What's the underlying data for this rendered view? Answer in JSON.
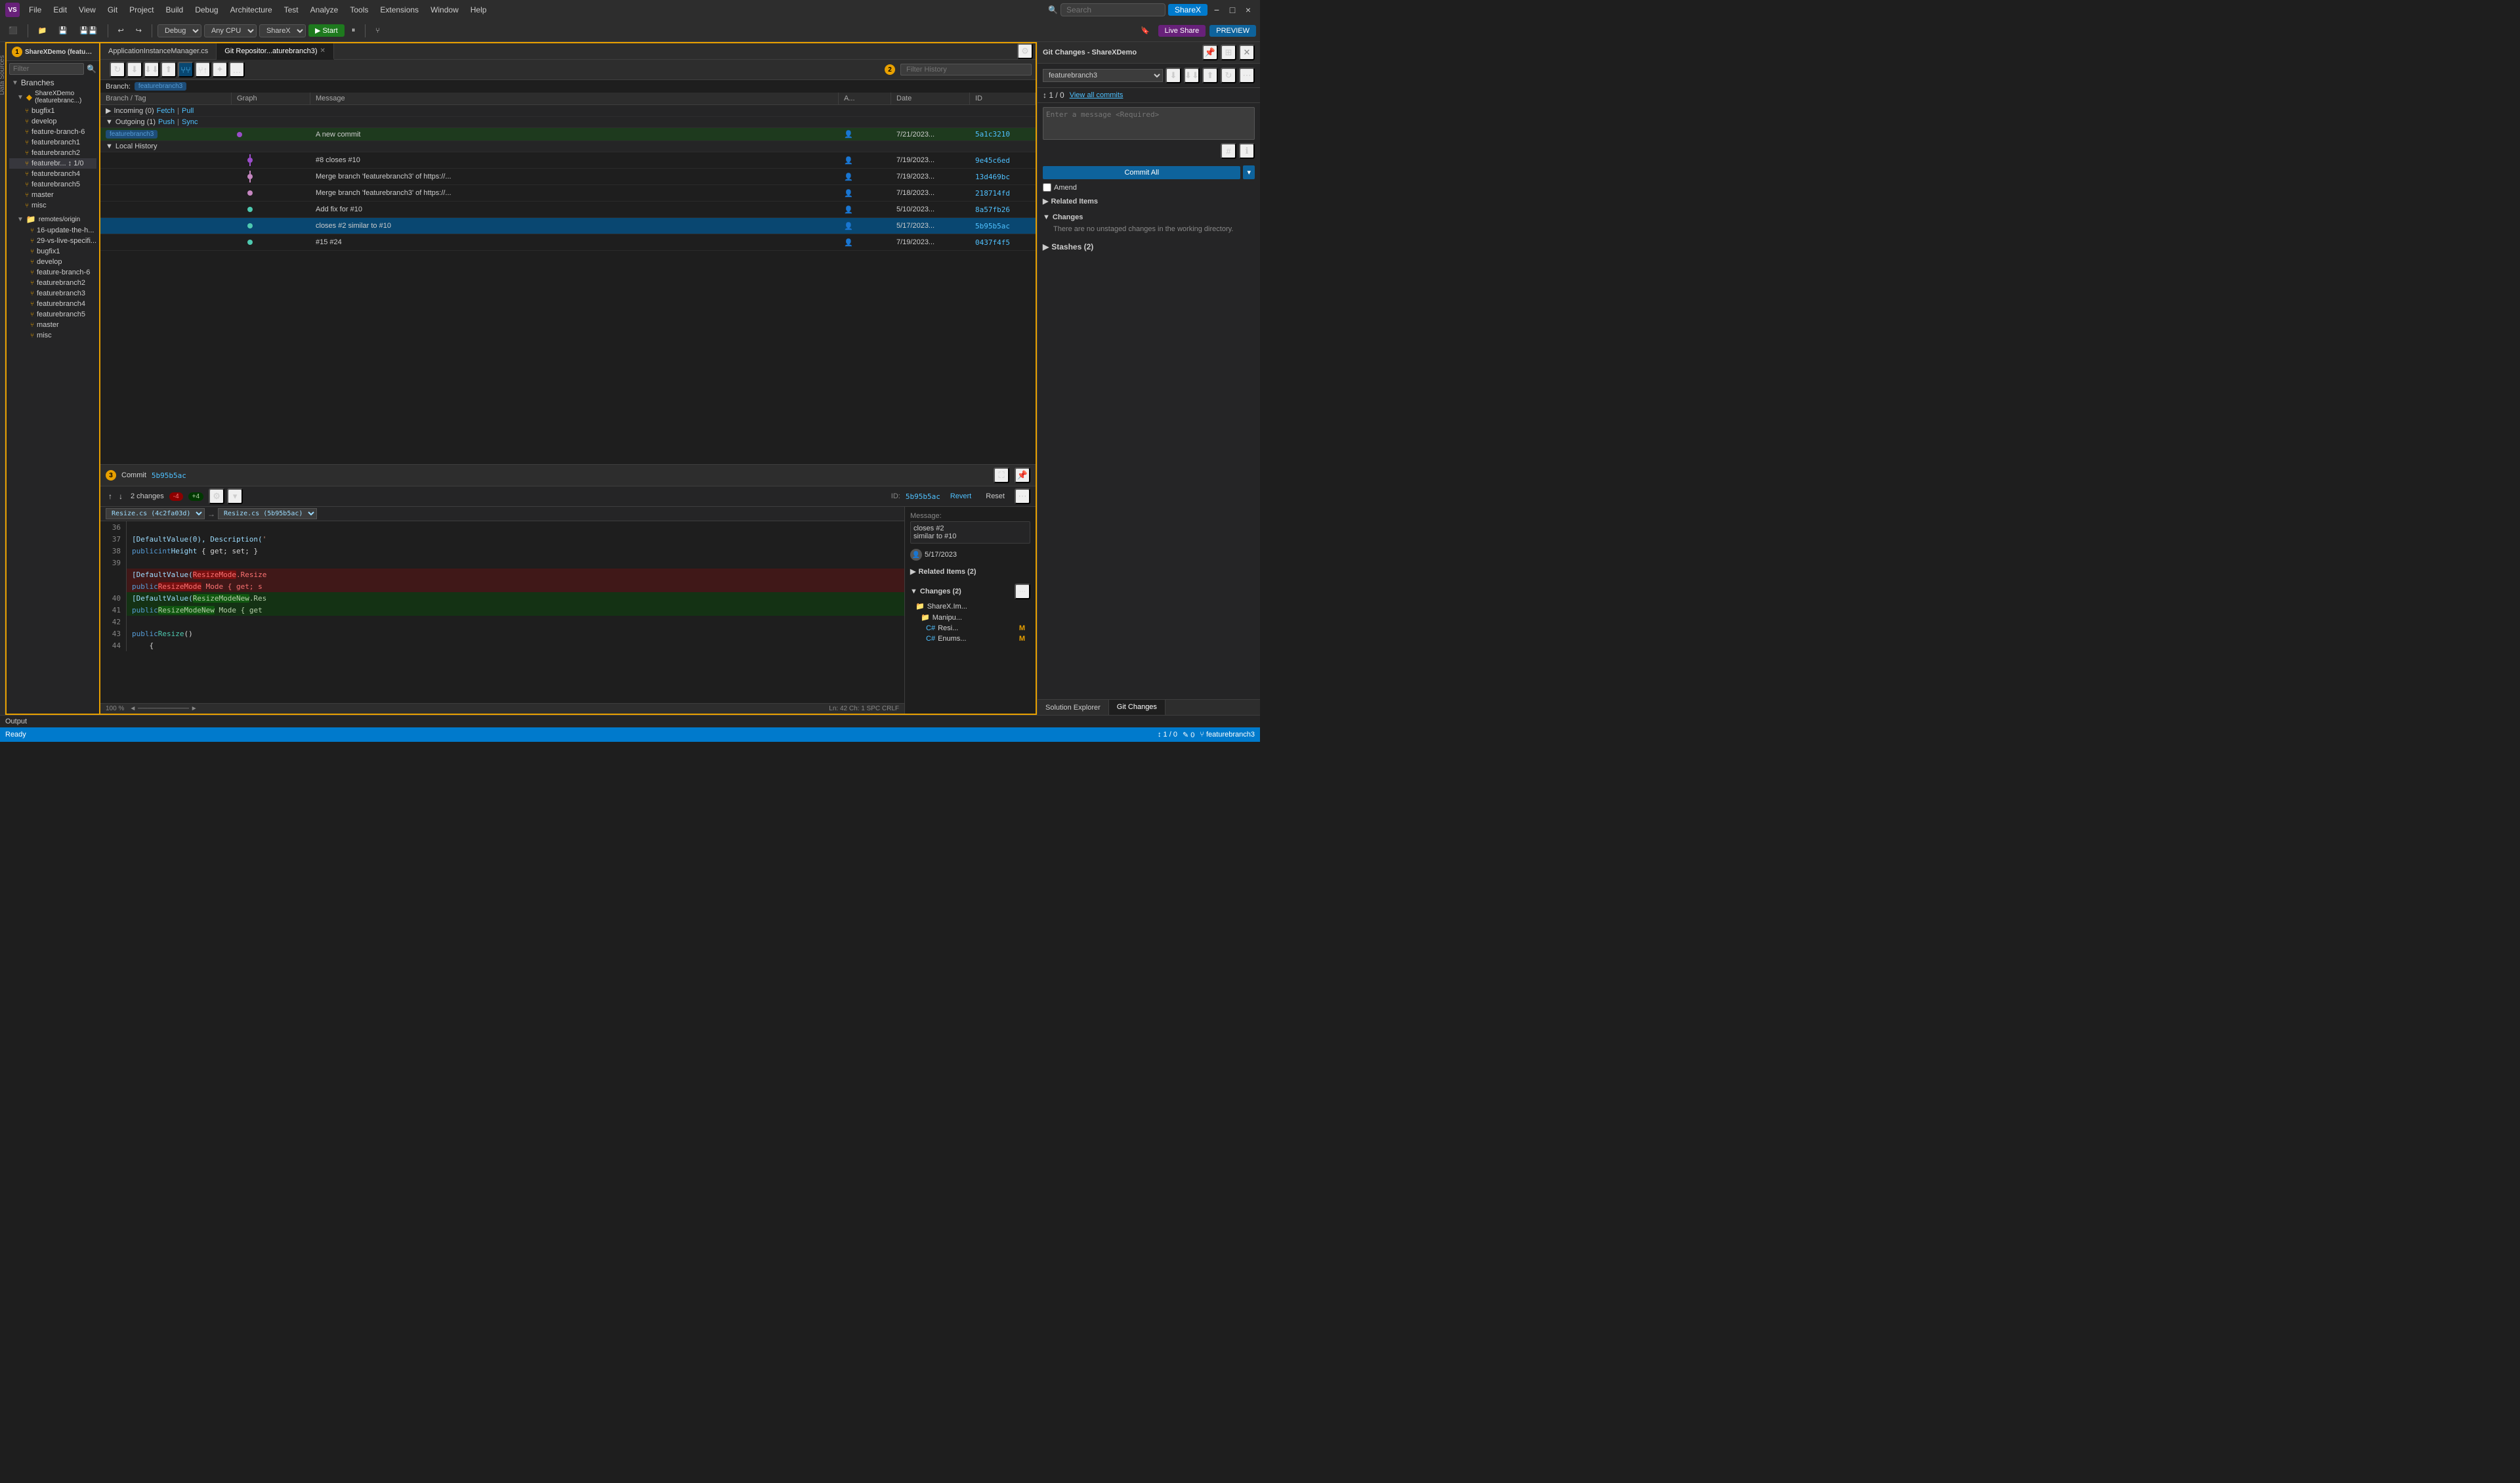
{
  "titlebar": {
    "logo": "VS",
    "menus": [
      "File",
      "Edit",
      "View",
      "Git",
      "Project",
      "Build",
      "Debug",
      "Architecture",
      "Test",
      "Analyze",
      "Tools",
      "Extensions",
      "Window",
      "Help"
    ],
    "search_placeholder": "Search",
    "active_tab": "ShareX",
    "win_buttons": [
      "−",
      "□",
      "×"
    ]
  },
  "toolbar": {
    "debug_config": "Debug",
    "platform": "Any CPU",
    "project": "ShareX",
    "run_label": "▶ Start",
    "liveshare_label": "Live Share",
    "preview_label": "PREVIEW"
  },
  "left_sidebar": {
    "label": "Data Sources"
  },
  "git_repo_panel": {
    "title": "ShareXDemo (featurebranch3)",
    "number": "1",
    "filter_placeholder": "Filter",
    "sections": {
      "branches_label": "Branches",
      "branches": [
        {
          "name": "ShareXDemo (featurebranc...",
          "type": "root",
          "icon": "◆"
        },
        {
          "name": "bugfix1",
          "type": "branch"
        },
        {
          "name": "develop",
          "type": "branch"
        },
        {
          "name": "feature-branch-6",
          "type": "branch"
        },
        {
          "name": "featurebranch1",
          "type": "branch"
        },
        {
          "name": "featurebranch2",
          "type": "branch"
        },
        {
          "name": "featurebr... ↕ 1/0",
          "type": "branch",
          "active": true
        },
        {
          "name": "featurebranch4",
          "type": "branch"
        },
        {
          "name": "featurebranch5",
          "type": "branch"
        },
        {
          "name": "master",
          "type": "branch"
        },
        {
          "name": "misc",
          "type": "branch"
        }
      ],
      "remotes_label": "remotes/origin",
      "remotes": [
        {
          "name": "16-update-the-h...",
          "type": "branch"
        },
        {
          "name": "29-vs-live-specifi...",
          "type": "branch"
        },
        {
          "name": "bugfix1",
          "type": "branch"
        },
        {
          "name": "develop",
          "type": "branch"
        },
        {
          "name": "feature-branch-6",
          "type": "branch"
        },
        {
          "name": "featurebranch2",
          "type": "branch"
        },
        {
          "name": "featurebranch3",
          "type": "branch"
        },
        {
          "name": "featurebranch4",
          "type": "branch"
        },
        {
          "name": "featurebranch5",
          "type": "branch"
        },
        {
          "name": "master",
          "type": "branch"
        },
        {
          "name": "misc",
          "type": "branch"
        }
      ]
    }
  },
  "git_history": {
    "number": "2",
    "branch_label": "Branch:",
    "branch_name": "featurebranch3",
    "filter_placeholder": "Filter History",
    "table_headers": [
      "Branch / Tag",
      "Graph",
      "Message",
      "A...",
      "Date",
      "ID"
    ],
    "incoming": {
      "label": "Incoming (0)",
      "fetch": "Fetch",
      "pull": "Pull"
    },
    "outgoing": {
      "label": "Outgoing (1)",
      "push": "Push",
      "sync": "Sync"
    },
    "outgoing_commits": [
      {
        "branch": "featurebranch3",
        "dot": "purple",
        "message": "A new commit",
        "author_icon": "👤",
        "date": "7/21/2023...",
        "id": "5a1c3210"
      }
    ],
    "local_history_label": "Local History",
    "history_rows": [
      {
        "message": "#8 closes #10",
        "author_icon": "👤",
        "date": "7/19/2023...",
        "id": "9e45c6ed"
      },
      {
        "message": "Merge branch 'featurebranch3' of https://...",
        "author_icon": "👤",
        "date": "7/19/2023...",
        "id": "13d469bc"
      },
      {
        "message": "Merge branch 'featurebranch3' of https://...",
        "author_icon": "👤",
        "date": "7/18/2023...",
        "id": "218714fd"
      },
      {
        "message": "Add fix for #10",
        "author_icon": "👤",
        "date": "5/10/2023...",
        "id": "8a57fb26"
      },
      {
        "message": "closes #2 similar to #10",
        "author_icon": "👤",
        "date": "5/17/2023...",
        "id": "5b95b5ac",
        "selected": true
      },
      {
        "message": "#15 #24",
        "author_icon": "👤",
        "date": "7/19/2023...",
        "id": "0437f4f5"
      }
    ]
  },
  "commit_detail": {
    "number": "3",
    "label": "Commit 5b95b5ac",
    "changes_count": "2 changes",
    "badge_red": "-4",
    "badge_green": "+4",
    "id_label": "ID:",
    "id_value": "5b95b5ac",
    "revert_label": "Revert",
    "reset_label": "Reset",
    "diff_file_from": "Resize.cs (4c2fa03d)",
    "diff_file_to": "Resize.cs (5b95b5ac)",
    "zoom": "100 %",
    "ln_col": "Ln: 42  Ch: 1  SPC  CRLF",
    "code_lines": [
      {
        "num": "36",
        "type": "normal",
        "content": ""
      },
      {
        "num": "37",
        "type": "normal",
        "content": "    [DefaultValue(0), Description("
      },
      {
        "num": "38",
        "type": "normal",
        "content": "    public int Height { get; set; }"
      },
      {
        "num": "39",
        "type": "normal",
        "content": ""
      },
      {
        "num": "40",
        "type": "removed",
        "content": "    [DefaultValue(ResizeMode.Resize"
      },
      {
        "num": "",
        "type": "removed",
        "content": "    public ResizeMode Mode { get; s"
      },
      {
        "num": "40",
        "type": "added",
        "content": "    [DefaultValue(ResizeModeNew.Res"
      },
      {
        "num": "41",
        "type": "added",
        "content": "    public ResizeModeNew Mode { get"
      },
      {
        "num": "42",
        "type": "normal",
        "content": ""
      },
      {
        "num": "43",
        "type": "normal",
        "content": "    public Resize()"
      },
      {
        "num": "44",
        "type": "normal",
        "content": "    {"
      }
    ],
    "message_label": "Message:",
    "message_text": "closes #2\nsimilar to #10",
    "author_date": "5/17/2023",
    "related_items_label": "Related Items (2)",
    "changes_label": "Changes (2)",
    "files": [
      {
        "folder": "ShareX.Im...",
        "type": "folder"
      },
      {
        "subfolder": "Manipu...",
        "type": "folder"
      },
      {
        "name": "C# Resi...",
        "status": "M"
      },
      {
        "name": "C# Enums...",
        "status": "M"
      }
    ]
  },
  "git_changes": {
    "title": "Git Changes - ShareXDemo",
    "branch_name": "featurebranch3",
    "commit_msg_placeholder": "Enter a message <Required>",
    "sync_label": "↕ 1 / 0",
    "view_all_commits": "View all commits",
    "commit_all_label": "Commit All",
    "amend_label": "Amend",
    "related_items_label": "Related Items",
    "changes_section_label": "Changes",
    "changes_empty_text": "There are no unstaged changes in the working directory.",
    "stashes_label": "Stashes (2)",
    "tabs": [
      "Solution Explorer",
      "Git Changes"
    ]
  },
  "status_bar": {
    "ready": "Ready",
    "commits": "↕ 1 / 0",
    "errors": "✎ 0",
    "branch": "⑂ featurebranch3"
  }
}
